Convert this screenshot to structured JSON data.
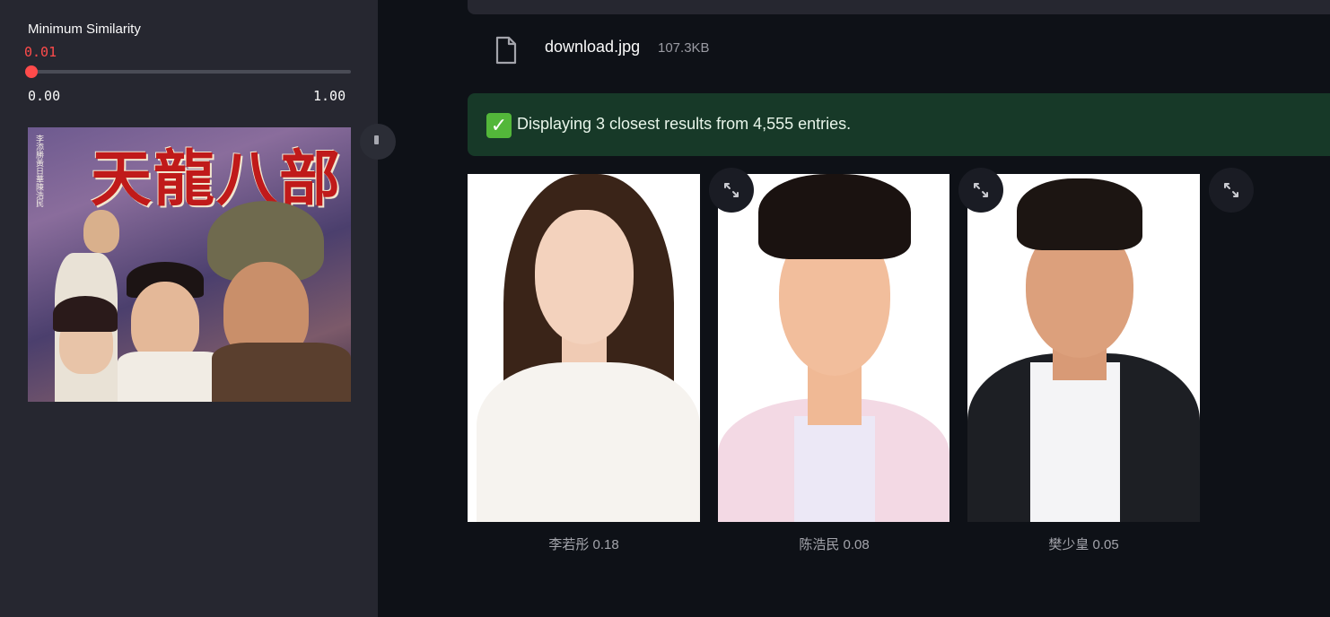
{
  "sidebar": {
    "slider": {
      "label": "Minimum Similarity",
      "value": "0.01",
      "value_fraction": 0.01,
      "min": "0.00",
      "max": "1.00",
      "accent": "#ff4b4b"
    },
    "poster": {
      "title_text": "天龍八部",
      "credits_text": "李添勝 黃日華 陳浩民 李若彤 樊少皇 劉錦玲 劉玉翠 張圖"
    },
    "collapse_icon": "chevron-icon"
  },
  "main": {
    "file": {
      "icon": "file-icon",
      "name": "download.jpg",
      "size": "107.3KB"
    },
    "alert": {
      "icon": "check-mark-icon",
      "icon_glyph": "✓",
      "text": "Displaying 3 closest results from 4,555 entries.",
      "background": "#173928"
    },
    "results": [
      {
        "caption": "李若彤 0.18"
      },
      {
        "caption": "陈浩民 0.08"
      },
      {
        "caption": "樊少皇 0.05"
      }
    ],
    "expand_icon": "fullscreen-expand-icon"
  },
  "colors": {
    "app_background": "#0e1117",
    "sidebar_background": "#262730",
    "text": "#fafafa"
  }
}
